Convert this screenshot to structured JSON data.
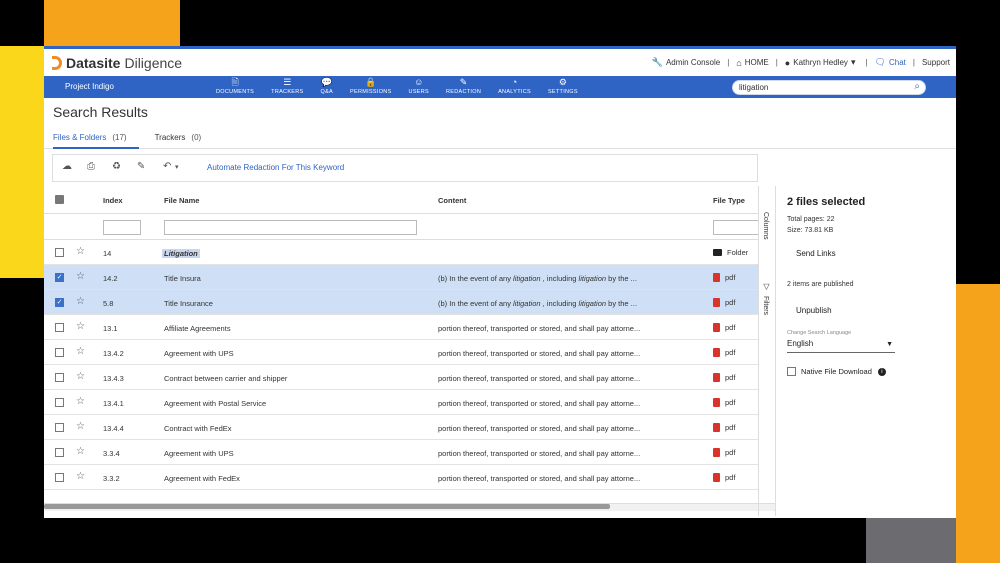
{
  "colors": {
    "brand_blue": "#2f64c5",
    "logo_orange": "#f08a24",
    "selection": "#cfe0f6",
    "pdf_red": "#d9342b"
  },
  "header": {
    "brand": "Datasite",
    "product": "Diligence",
    "admin_console": "Admin Console",
    "home": "HOME",
    "user": "Kathryn Hedley",
    "chat": "Chat",
    "support": "Support"
  },
  "nav": {
    "project": "Project Indigo",
    "items": [
      {
        "label": "DOCUMENTS",
        "icon": "documents-icon"
      },
      {
        "label": "TRACKERS",
        "icon": "trackers-icon"
      },
      {
        "label": "Q&A",
        "icon": "qa-icon"
      },
      {
        "label": "PERMISSIONS",
        "icon": "lock-icon"
      },
      {
        "label": "USERS",
        "icon": "users-icon"
      },
      {
        "label": "REDACTION",
        "icon": "pen-icon"
      },
      {
        "label": "ANALYTICS",
        "icon": "pie-chart-icon"
      },
      {
        "label": "SETTINGS",
        "icon": "gear-icon"
      }
    ],
    "search_value": "litigation"
  },
  "page": {
    "title": "Search Results",
    "tabs": [
      {
        "label": "Files & Folders",
        "count": "(17)"
      },
      {
        "label": "Trackers",
        "count": "(0)"
      }
    ],
    "automate_redaction": "Automate Redaction For This Keyword"
  },
  "grid": {
    "columns": {
      "index": "Index",
      "file_name": "File Name",
      "content": "Content",
      "file_type": "File Type"
    },
    "rows": [
      {
        "index": "14",
        "name": "Litigation",
        "content": "",
        "type": "Folder",
        "selected": false
      },
      {
        "index": "14.2",
        "name": "Title Insura",
        "content_pre": "(b) In the event of any ",
        "content_kw": "litigation",
        "content_mid": " , including ",
        "content_kw2": "litigation",
        "content_post": " by the ...",
        "type": "pdf",
        "selected": true
      },
      {
        "index": "5.8",
        "name": "Title Insurance",
        "content_pre": "(b) In the event of any ",
        "content_kw": "litigation",
        "content_mid": " , including ",
        "content_kw2": "litigation",
        "content_post": " by the ...",
        "type": "pdf",
        "selected": true
      },
      {
        "index": "13.1",
        "name": "Affiliate Agreements",
        "content": "portion thereof, transported or stored, and shall pay attorne...",
        "type": "pdf",
        "selected": false
      },
      {
        "index": "13.4.2",
        "name": "Agreement with UPS",
        "content": "portion thereof, transported or stored, and shall pay attorne...",
        "type": "pdf",
        "selected": false
      },
      {
        "index": "13.4.3",
        "name": "Contract between carrier and shipper",
        "content": "portion thereof, transported or stored, and shall pay attorne...",
        "type": "pdf",
        "selected": false
      },
      {
        "index": "13.4.1",
        "name": "Agreement with Postal Service",
        "content": "portion thereof, transported or stored, and shall pay attorne...",
        "type": "pdf",
        "selected": false
      },
      {
        "index": "13.4.4",
        "name": "Contract with FedEx",
        "content": "portion thereof, transported or stored, and shall pay attorne...",
        "type": "pdf",
        "selected": false
      },
      {
        "index": "3.3.4",
        "name": "Agreement with UPS",
        "content": "portion thereof, transported or stored, and shall pay attorne...",
        "type": "pdf",
        "selected": false
      },
      {
        "index": "3.3.2",
        "name": "Agreement with FedEx",
        "content": "portion thereof, transported or stored, and shall pay attorne...",
        "type": "pdf",
        "selected": false
      }
    ]
  },
  "side_tabs": {
    "columns": "Columns",
    "filters": "Filters"
  },
  "panel": {
    "title": "2 files selected",
    "total_pages": "Total pages: 22",
    "size": "Size: 73.81 KB",
    "send_links": "Send Links",
    "published": "2 items are published",
    "unpublish": "Unpublish",
    "language_label": "Change Search Language",
    "language_value": "English",
    "native_download": "Native File Download"
  }
}
